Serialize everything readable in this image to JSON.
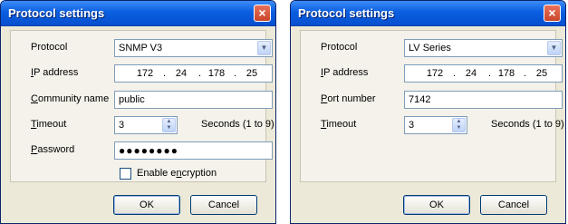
{
  "dialogs": [
    {
      "title": "Protocol settings",
      "protocol_label": "Protocol",
      "protocol_value": "SNMP V3",
      "ip_label_mnemonic": "I",
      "ip_label_rest": "P address",
      "ip_octets": [
        "172",
        "24",
        "178",
        "25"
      ],
      "ip_separator": ".",
      "community_label_mnemonic": "C",
      "community_label_rest": "ommunity name",
      "community_value": "public",
      "timeout_label_mnemonic": "T",
      "timeout_label_rest": "imeout",
      "timeout_value": "3",
      "timeout_hint": "Seconds (1 to 9)",
      "password_label_mnemonic": "P",
      "password_label_rest": "assword",
      "password_mask": "●●●●●●●●",
      "encryption_label_before": "Enable e",
      "encryption_label_mnemonic": "n",
      "encryption_label_after": "cryption",
      "encryption_checked": false,
      "ok_label": "OK",
      "cancel_label": "Cancel"
    },
    {
      "title": "Protocol settings",
      "protocol_label": "Protocol",
      "protocol_value": "LV Series",
      "ip_label_mnemonic": "I",
      "ip_label_rest": "P address",
      "ip_octets": [
        "172",
        "24",
        "178",
        "25"
      ],
      "ip_separator": ".",
      "port_label_mnemonic": "P",
      "port_label_rest": "ort number",
      "port_value": "7142",
      "timeout_label_mnemonic": "T",
      "timeout_label_rest": "imeout",
      "timeout_value": "3",
      "timeout_hint": "Seconds (1 to 9)",
      "ok_label": "OK",
      "cancel_label": "Cancel"
    }
  ],
  "icons": {
    "close": "×",
    "dropdown": "▼",
    "spin_up": "▲",
    "spin_down": "▼"
  },
  "colors": {
    "titlebar": "#0a5fe0",
    "close_button": "#d3543a",
    "dialog_bg": "#ece9d8"
  }
}
